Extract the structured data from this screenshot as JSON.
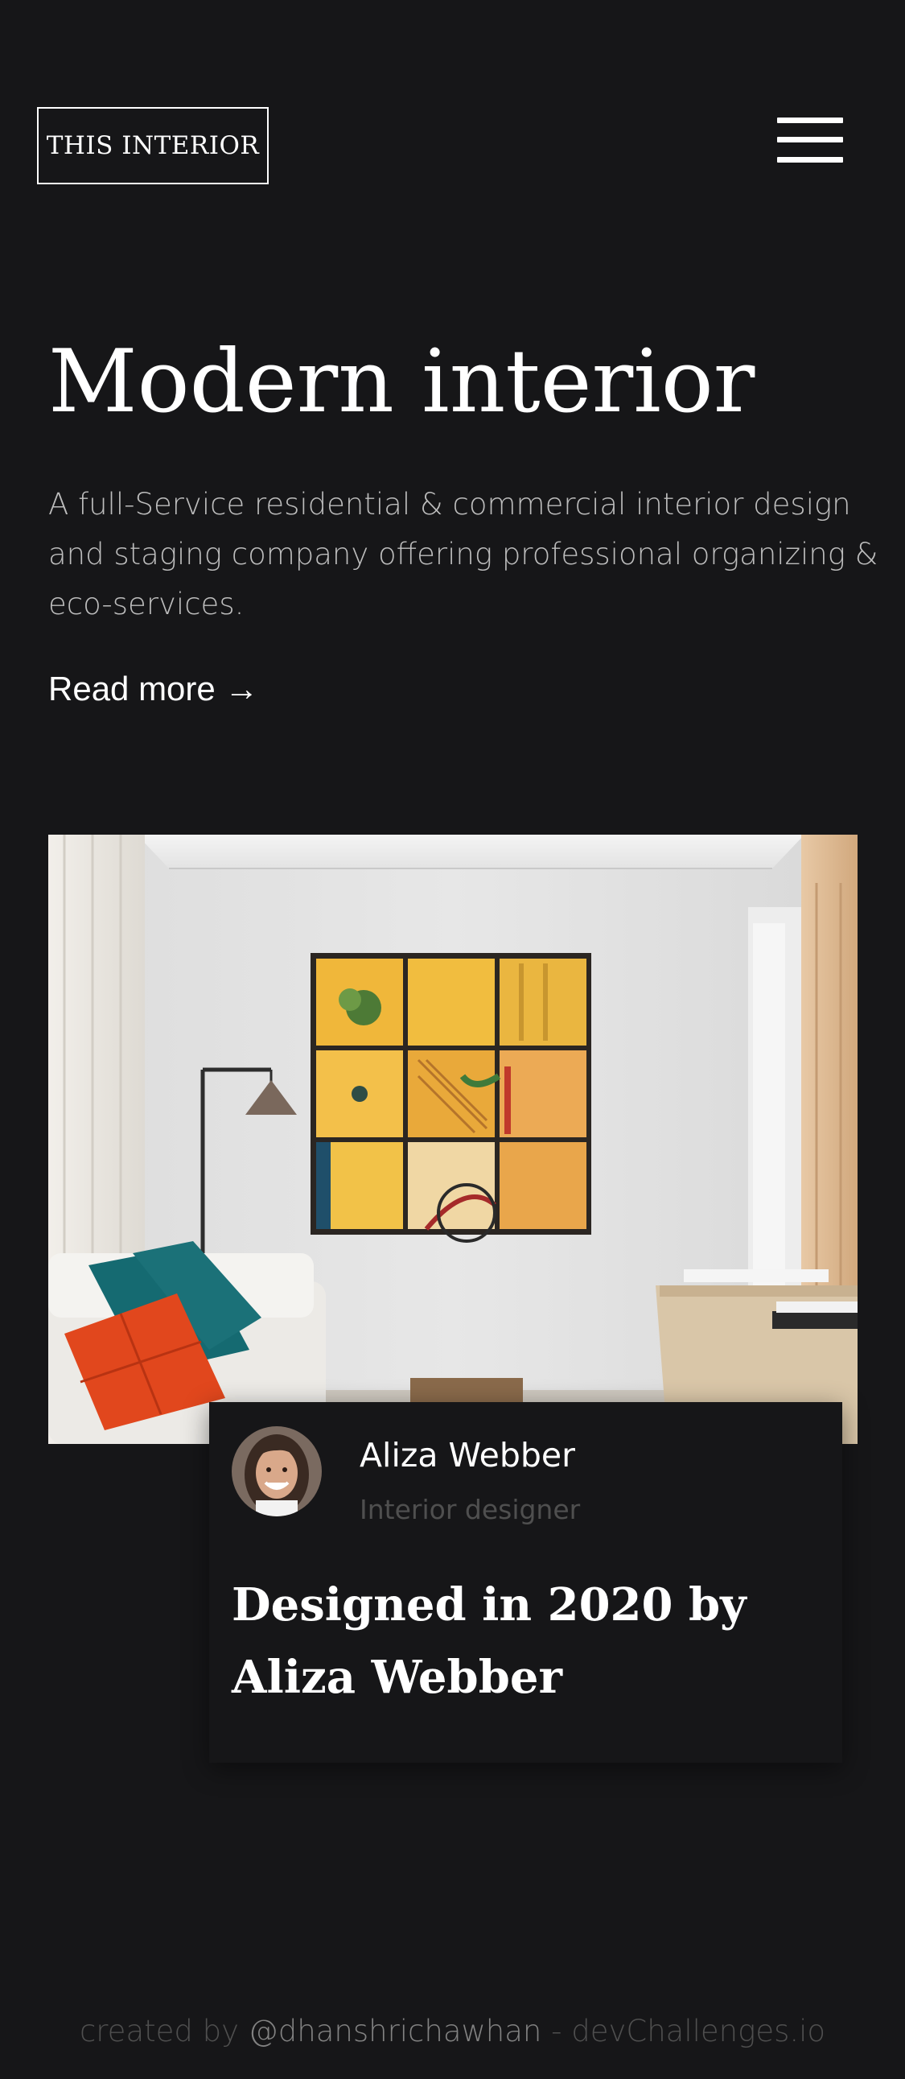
{
  "header": {
    "logo_text": "THIS INTERIOR",
    "menu_icon": "hamburger-menu-icon"
  },
  "hero": {
    "title": "Modern interior",
    "description": "A full-Service residential & commercial interior design and staging company offering professional organizing & eco-services.",
    "read_more_label": "Read more →"
  },
  "feature": {
    "image_alt": "Living room with yellow wall art, sofa with cushions and floor lamp",
    "author": {
      "name": "Aliza Webber",
      "role": "Interior designer"
    },
    "title": "Designed in 2020 by Aliza Webber"
  },
  "footer": {
    "prefix": "created by ",
    "handle": "@dhanshrichawhan",
    "suffix": " - devChallenges.io"
  },
  "colors": {
    "background": "#161618",
    "text": "#ffffff",
    "muted": "#bdbdbd",
    "dim": "#4f4f4f",
    "footer_handle": "#828282"
  }
}
